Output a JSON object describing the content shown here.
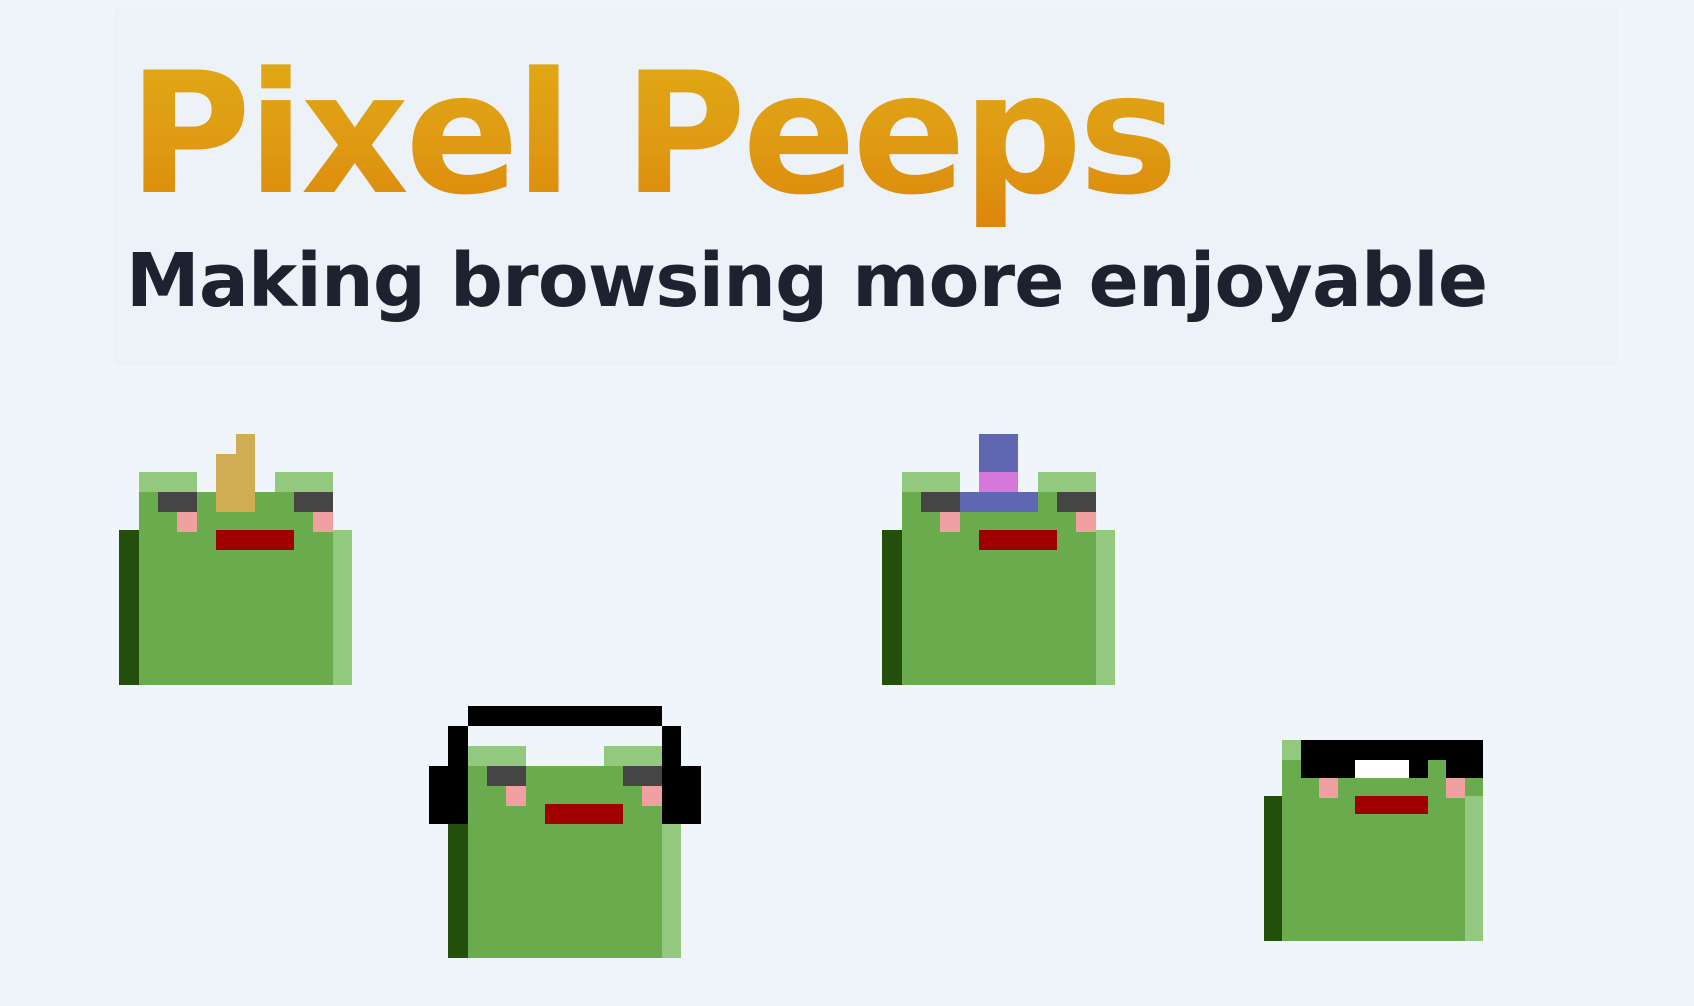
{
  "header": {
    "title": "Pixel Peeps",
    "subtitle": "Making browsing more enjoyable"
  },
  "colors": {
    "background": "#f0f5fc",
    "title_gradient_top": "#e0ab16",
    "title_gradient_bottom": "#dc860b",
    "subtitle": "#1c2230",
    "frog_body": "#6aab4d",
    "frog_light": "#92c97e",
    "frog_dark": "#234f0d",
    "eye": "#454545",
    "cheek": "#f0a0a0",
    "mouth": "#a00000",
    "crown": "#d0ac52",
    "hat_purple": "#5f67b3",
    "hat_pink": "#d678d9",
    "headphones": "#000000",
    "sunglasses": "#000000",
    "glasses_shine": "#ffffff"
  },
  "pets": [
    {
      "name": "frog-with-crown",
      "accessory": "crown-icon"
    },
    {
      "name": "frog-with-party-hat",
      "accessory": "party-hat-icon"
    },
    {
      "name": "frog-with-headphones",
      "accessory": "headphones-icon"
    },
    {
      "name": "frog-with-sunglasses",
      "accessory": "sunglasses-icon"
    }
  ]
}
